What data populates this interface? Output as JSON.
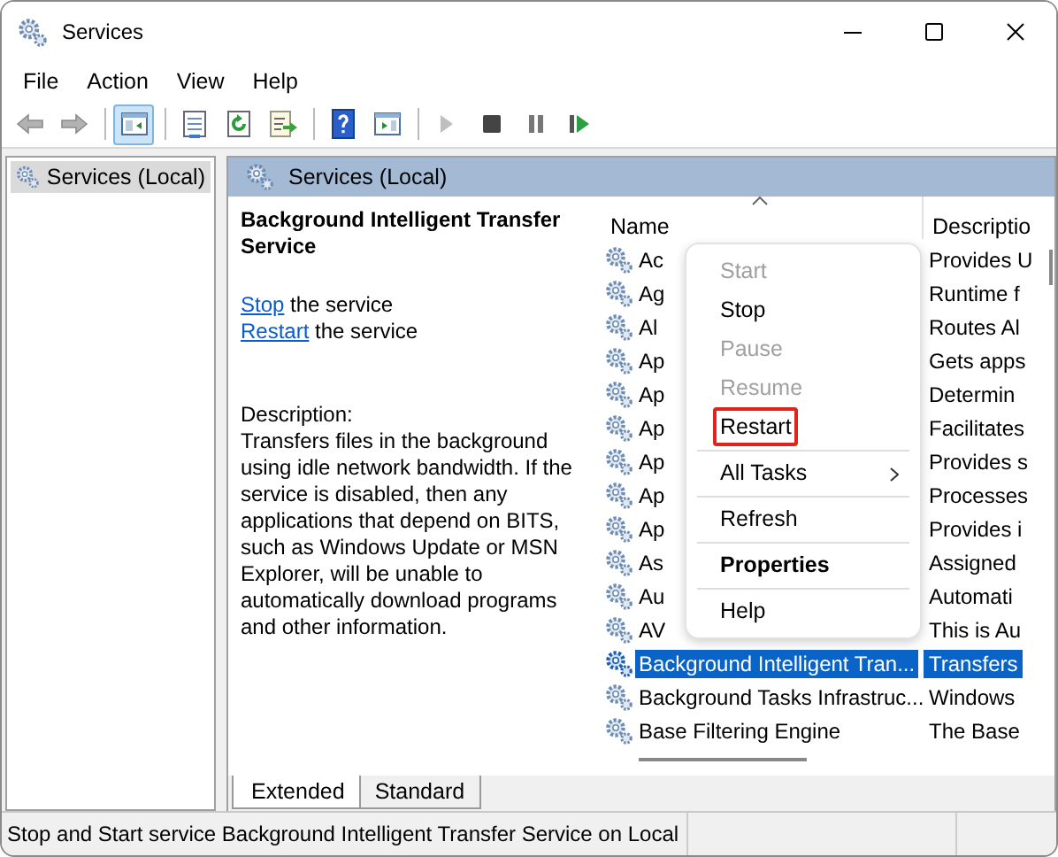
{
  "window": {
    "title": "Services"
  },
  "menu_bar": [
    "File",
    "Action",
    "View",
    "Help"
  ],
  "toolbar": [
    {
      "kind": "back",
      "disabled": true,
      "pressed": false
    },
    {
      "kind": "forward",
      "disabled": true,
      "pressed": false
    },
    {
      "kind": "separator"
    },
    {
      "kind": "tree",
      "disabled": false,
      "pressed": true
    },
    {
      "kind": "separator"
    },
    {
      "kind": "properties",
      "disabled": false,
      "pressed": false
    },
    {
      "kind": "refresh",
      "disabled": false,
      "pressed": false
    },
    {
      "kind": "export",
      "disabled": false,
      "pressed": false
    },
    {
      "kind": "separator"
    },
    {
      "kind": "help",
      "disabled": false,
      "pressed": false
    },
    {
      "kind": "pane",
      "disabled": false,
      "pressed": false
    },
    {
      "kind": "separator"
    },
    {
      "kind": "start",
      "disabled": true,
      "pressed": false
    },
    {
      "kind": "stop",
      "disabled": false,
      "pressed": false
    },
    {
      "kind": "pause",
      "disabled": false,
      "pressed": false
    },
    {
      "kind": "restart",
      "disabled": false,
      "pressed": false
    }
  ],
  "tree": {
    "items": [
      {
        "label": "Services (Local)",
        "selected": true
      }
    ]
  },
  "pane_header": {
    "title": "Services (Local)"
  },
  "details": {
    "title": "Background Intelligent Transfer Service",
    "actions": [
      {
        "link": "Stop",
        "text": "the service"
      },
      {
        "link": "Restart",
        "text": "the service"
      }
    ],
    "description_label": "Description:",
    "description": "Transfers files in the background using idle network bandwidth. If the service is disabled, then any applications that depend on BITS, such as Windows Update or MSN Explorer, will be unable to automatically download programs and other information."
  },
  "table": {
    "columns": [
      "Name",
      "Descriptio"
    ],
    "rows": [
      {
        "name": "Ac",
        "description": "Provides U",
        "selected": false
      },
      {
        "name": "Ag",
        "description": "Runtime f",
        "selected": false
      },
      {
        "name": "Al",
        "description": "Routes Al",
        "selected": false
      },
      {
        "name": "Ap",
        "description": "Gets apps",
        "selected": false
      },
      {
        "name": "Ap",
        "description": "Determin",
        "selected": false
      },
      {
        "name": "Ap",
        "description": "Facilitates",
        "selected": false
      },
      {
        "name": "Ap",
        "description": "Provides s",
        "selected": false
      },
      {
        "name": "Ap",
        "description": "Processes",
        "selected": false
      },
      {
        "name": "Ap",
        "description": "Provides i",
        "selected": false
      },
      {
        "name": "As",
        "description": "Assigned",
        "selected": false
      },
      {
        "name": "Au",
        "description": "Automati",
        "selected": false
      },
      {
        "name": "AV",
        "description": "This is Au",
        "selected": false
      },
      {
        "name": "Background Intelligent Tran...",
        "description": "Transfers",
        "selected": true
      },
      {
        "name": "Background Tasks Infrastruc...",
        "description": "Windows",
        "selected": false
      },
      {
        "name": "Base Filtering Engine",
        "description": "The Base",
        "selected": false
      }
    ]
  },
  "context_menu": [
    {
      "kind": "item",
      "label": "Start",
      "disabled": true,
      "bold": false,
      "submenu": false,
      "outlined": false
    },
    {
      "kind": "item",
      "label": "Stop",
      "disabled": false,
      "bold": false,
      "submenu": false,
      "outlined": false
    },
    {
      "kind": "item",
      "label": "Pause",
      "disabled": true,
      "bold": false,
      "submenu": false,
      "outlined": false
    },
    {
      "kind": "item",
      "label": "Resume",
      "disabled": true,
      "bold": false,
      "submenu": false,
      "outlined": false
    },
    {
      "kind": "item",
      "label": "Restart",
      "disabled": false,
      "bold": false,
      "submenu": false,
      "outlined": true
    },
    {
      "kind": "separator"
    },
    {
      "kind": "item",
      "label": "All Tasks",
      "disabled": false,
      "bold": false,
      "submenu": true,
      "outlined": false
    },
    {
      "kind": "separator"
    },
    {
      "kind": "item",
      "label": "Refresh",
      "disabled": false,
      "bold": false,
      "submenu": false,
      "outlined": false
    },
    {
      "kind": "separator"
    },
    {
      "kind": "item",
      "label": "Properties",
      "disabled": false,
      "bold": true,
      "submenu": false,
      "outlined": false
    },
    {
      "kind": "separator"
    },
    {
      "kind": "item",
      "label": "Help",
      "disabled": false,
      "bold": false,
      "submenu": false,
      "outlined": false
    }
  ],
  "tabs": [
    {
      "label": "Extended",
      "selected": true
    },
    {
      "label": "Standard",
      "selected": false
    }
  ],
  "status_bar": {
    "text": "Stop and Start service Background Intelligent Transfer Service on Local"
  }
}
